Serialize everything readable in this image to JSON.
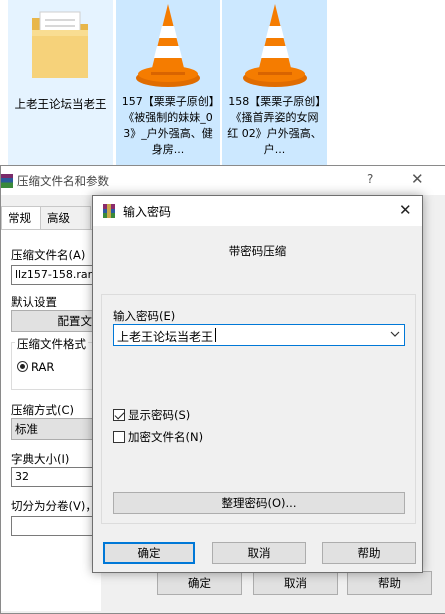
{
  "desktop": {
    "items": [
      {
        "label": "上老王论坛当老王",
        "icon": "folder-icon"
      },
      {
        "label": "157【栗栗子原创】《被强制的妹妹_03》_户外强高、健身房...",
        "icon": "vlc-cone-icon"
      },
      {
        "label": "158【栗栗子原创】《搔首弄姿的女网红 02》户外强高、户...",
        "icon": "vlc-cone-icon"
      }
    ]
  },
  "back_dialog": {
    "title": "压缩文件名和参数",
    "help": "?",
    "close": "✕",
    "tabs": [
      "常规",
      "高级"
    ],
    "archive_name_label": "压缩文件名(A)",
    "archive_name_value": "llz157-158.rar",
    "default_settings_label": "默认设置",
    "profiles_button": "配置文",
    "format_label": "压缩文件格式",
    "format_rar": "RAR",
    "method_label": "压缩方式(C)",
    "method_value": "标准",
    "dict_label": "字典大小(I)",
    "dict_value": "32",
    "split_label": "切分为分卷(V)，",
    "ok": "确定",
    "cancel": "取消",
    "help_button": "帮助"
  },
  "password_dialog": {
    "title": "输入密码",
    "close": "✕",
    "subheading": "带密码压缩",
    "enter_label": "输入密码(E)",
    "password_value": "上老王论坛当老王",
    "show_password": "显示密码(S)",
    "show_password_checked": true,
    "encrypt_names": "加密文件名(N)",
    "encrypt_names_checked": false,
    "organize_button": "整理密码(O)...",
    "ok": "确定",
    "cancel": "取消",
    "help_button": "帮助"
  },
  "colors": {
    "selection_bg": "#cce8ff",
    "focus_border": "#0078d7",
    "vlc_orange": "#f57c00"
  }
}
